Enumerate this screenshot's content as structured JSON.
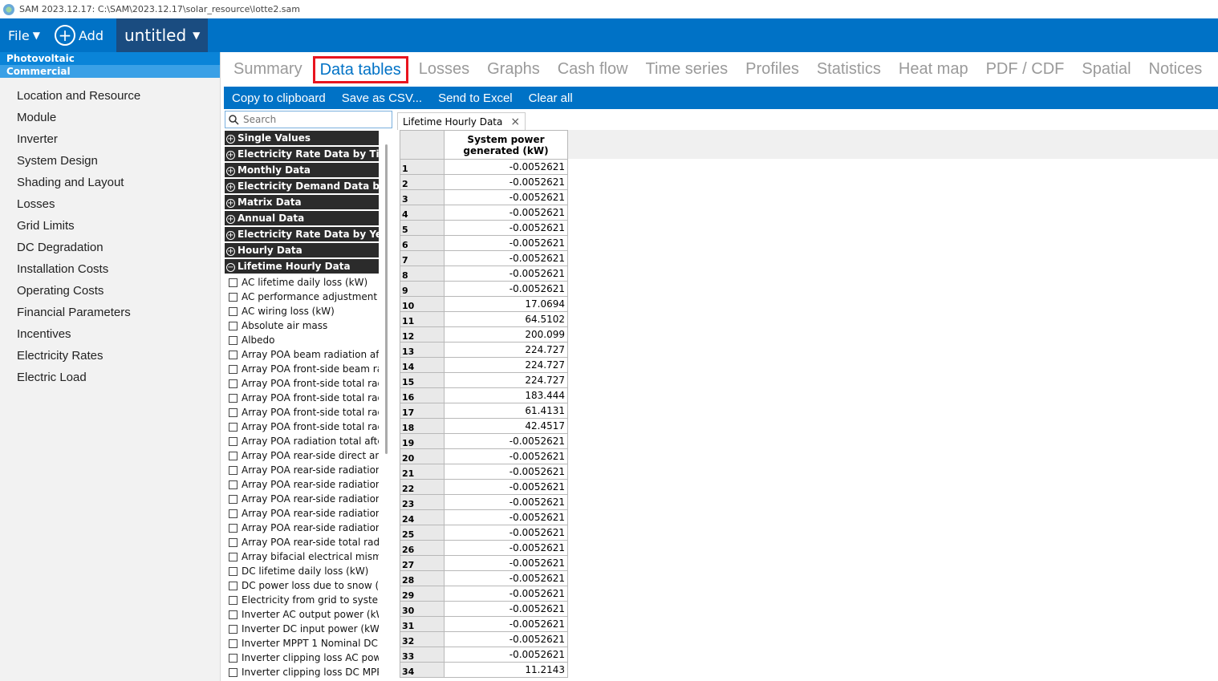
{
  "window": {
    "title": "SAM 2023.12.17: C:\\SAM\\2023.12.17\\solar_resource\\lotte2.sam"
  },
  "menubar": {
    "file_label": "File",
    "add_label": "Add",
    "case_name": "untitled"
  },
  "left": {
    "technology": "Photovoltaic",
    "financial": "Commercial",
    "items": [
      "Location and Resource",
      "Module",
      "Inverter",
      "System Design",
      "Shading and Layout",
      "Losses",
      "Grid Limits",
      "DC Degradation",
      "Installation Costs",
      "Operating Costs",
      "Financial Parameters",
      "Incentives",
      "Electricity Rates",
      "Electric Load"
    ]
  },
  "tabs": [
    "Summary",
    "Data tables",
    "Losses",
    "Graphs",
    "Cash flow",
    "Time series",
    "Profiles",
    "Statistics",
    "Heat map",
    "PDF / CDF",
    "Spatial",
    "Notices"
  ],
  "active_tab": "Data tables",
  "toolbar": {
    "copy": "Copy to clipboard",
    "save_csv": "Save as CSV...",
    "send_excel": "Send to Excel",
    "clear_all": "Clear all"
  },
  "search": {
    "placeholder": "Search"
  },
  "groups": [
    {
      "label": "Single Values",
      "symbol": "+"
    },
    {
      "label": "Electricity Rate Data by Tier and Period",
      "symbol": "+"
    },
    {
      "label": "Monthly Data",
      "symbol": "+"
    },
    {
      "label": "Electricity Demand Data by Period",
      "symbol": "+"
    },
    {
      "label": "Matrix Data",
      "symbol": "+"
    },
    {
      "label": "Annual Data",
      "symbol": "+"
    },
    {
      "label": "Electricity Rate Data by Year",
      "symbol": "+"
    },
    {
      "label": "Hourly Data",
      "symbol": "+"
    },
    {
      "label": "Lifetime Hourly Data",
      "symbol": "−"
    }
  ],
  "variables": [
    "AC lifetime daily loss (kW)",
    "AC performance adjustment loss (kW)",
    "AC wiring loss (kW)",
    "Absolute air mass",
    "Albedo",
    "Array POA beam radiation after shading",
    "Array POA front-side beam radiation",
    "Array POA front-side total radiation",
    "Array POA front-side total radiation",
    "Array POA front-side total radiation",
    "Array POA front-side total radiation",
    "Array POA radiation total after soiling",
    "Array POA rear-side direct and diffuse",
    "Array POA rear-side radiation blocked",
    "Array POA rear-side radiation blocked",
    "Array POA rear-side radiation blocked",
    "Array POA rear-side radiation reflected",
    "Array POA rear-side radiation reflected",
    "Array POA rear-side total radiation",
    "Array bifacial electrical mismatch loss",
    "DC lifetime daily loss (kW)",
    "DC power loss due to snow (kW)",
    "Electricity from grid to system (kW)",
    "Inverter AC output power (kW)",
    "Inverter DC input power (kW)",
    "Inverter MPPT 1 Nominal DC voltage",
    "Inverter clipping loss AC power limit",
    "Inverter clipping loss DC MPPT voltage"
  ],
  "data_tab": {
    "label": "Lifetime Hourly Data"
  },
  "table": {
    "column_header": "System power generated (kW)",
    "rows": [
      [
        "1",
        "-0.0052621"
      ],
      [
        "2",
        "-0.0052621"
      ],
      [
        "3",
        "-0.0052621"
      ],
      [
        "4",
        "-0.0052621"
      ],
      [
        "5",
        "-0.0052621"
      ],
      [
        "6",
        "-0.0052621"
      ],
      [
        "7",
        "-0.0052621"
      ],
      [
        "8",
        "-0.0052621"
      ],
      [
        "9",
        "-0.0052621"
      ],
      [
        "10",
        "17.0694"
      ],
      [
        "11",
        "64.5102"
      ],
      [
        "12",
        "200.099"
      ],
      [
        "13",
        "224.727"
      ],
      [
        "14",
        "224.727"
      ],
      [
        "15",
        "224.727"
      ],
      [
        "16",
        "183.444"
      ],
      [
        "17",
        "61.4131"
      ],
      [
        "18",
        "42.4517"
      ],
      [
        "19",
        "-0.0052621"
      ],
      [
        "20",
        "-0.0052621"
      ],
      [
        "21",
        "-0.0052621"
      ],
      [
        "22",
        "-0.0052621"
      ],
      [
        "23",
        "-0.0052621"
      ],
      [
        "24",
        "-0.0052621"
      ],
      [
        "25",
        "-0.0052621"
      ],
      [
        "26",
        "-0.0052621"
      ],
      [
        "27",
        "-0.0052621"
      ],
      [
        "28",
        "-0.0052621"
      ],
      [
        "29",
        "-0.0052621"
      ],
      [
        "30",
        "-0.0052621"
      ],
      [
        "31",
        "-0.0052621"
      ],
      [
        "32",
        "-0.0052621"
      ],
      [
        "33",
        "-0.0052621"
      ],
      [
        "34",
        "11.2143"
      ]
    ]
  }
}
